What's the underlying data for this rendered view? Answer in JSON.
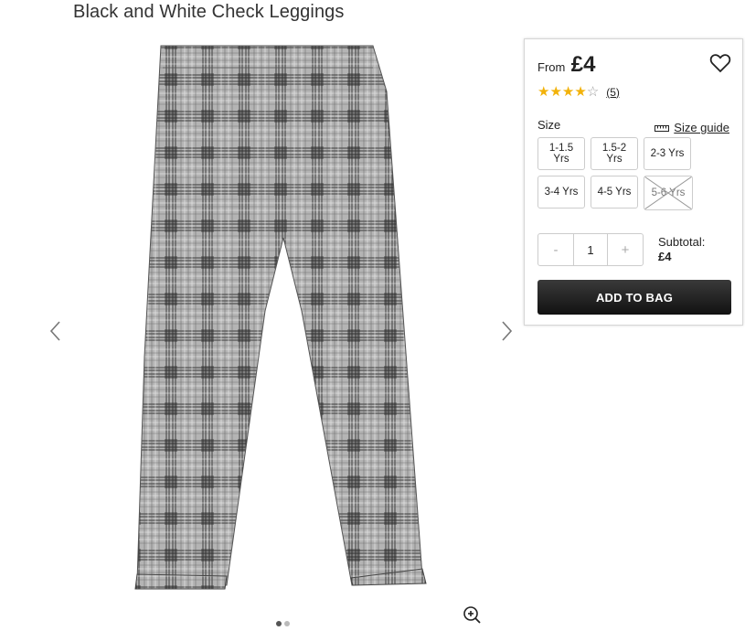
{
  "product": {
    "title": "Black and White Check Leggings"
  },
  "gallery": {
    "prev_icon": "chevron-left-icon",
    "next_icon": "chevron-right-icon",
    "zoom_icon": "zoom-in-icon",
    "slide_count": 2,
    "active_slide": 1
  },
  "price": {
    "from_label": "From",
    "value": "£4"
  },
  "rating": {
    "stars": 4,
    "max": 5,
    "count": "(5)",
    "star_color": "#f2b20a"
  },
  "size": {
    "label": "Size",
    "guide_label": "Size guide",
    "options": [
      {
        "label": "1-1.5 Yrs",
        "available": true
      },
      {
        "label": "1.5-2 Yrs",
        "available": true
      },
      {
        "label": "2-3 Yrs",
        "available": true
      },
      {
        "label": "3-4 Yrs",
        "available": true
      },
      {
        "label": "4-5 Yrs",
        "available": true
      },
      {
        "label": "5-6 Yrs",
        "available": false
      }
    ]
  },
  "quantity": {
    "minus": "-",
    "value": "1",
    "plus": "+"
  },
  "subtotal": {
    "label": "Subtotal:",
    "value": "£4"
  },
  "add_to_bag": {
    "label": "ADD TO BAG",
    "color": "#1a1a1a"
  }
}
